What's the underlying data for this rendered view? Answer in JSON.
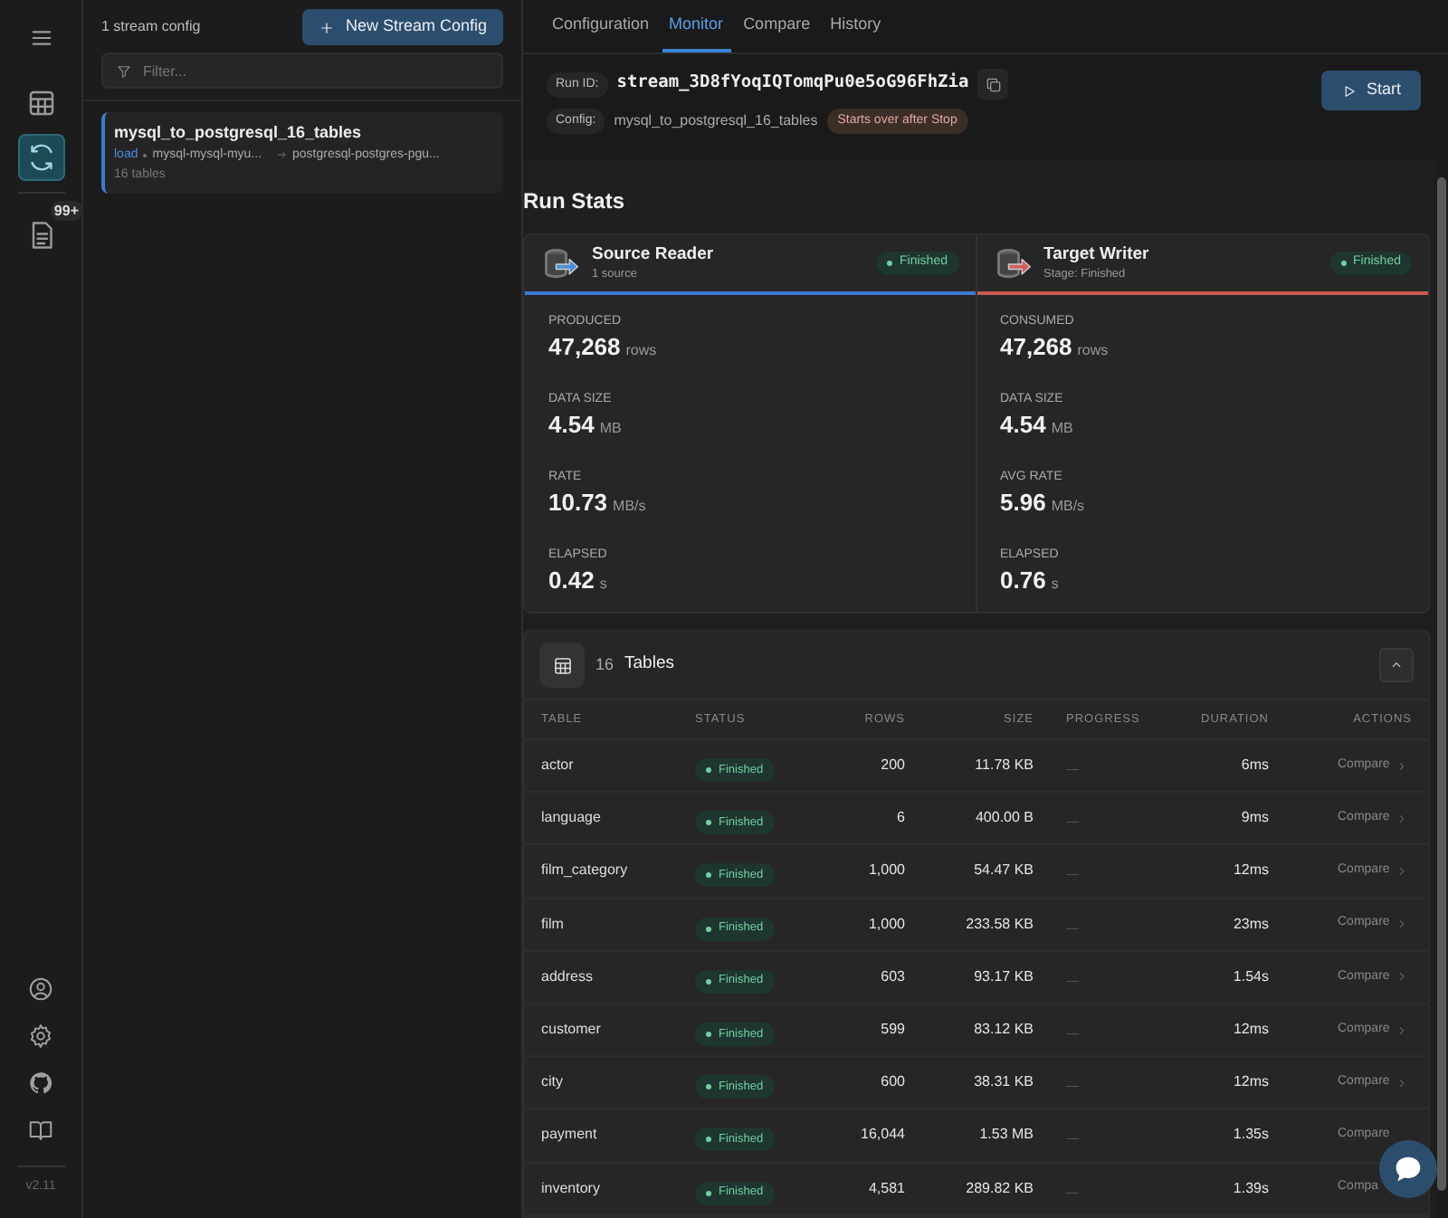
{
  "rail": {
    "items": [
      {
        "selected": false
      },
      {
        "selected": true
      },
      {
        "selected": false,
        "badge": "99+"
      }
    ],
    "version": "v2.11"
  },
  "sidebar": {
    "count": "1 stream config",
    "new_button": "New Stream Config",
    "filter": {
      "placeholder": "Filter..."
    },
    "configs": [
      {
        "name": "mysql_to_postgresql_16_tables",
        "mode": "load",
        "source": "mysql-mysql-myu...",
        "target": "postgresql-postgres-pgu...",
        "tables": "16 tables",
        "selected": true
      }
    ]
  },
  "tabs": [
    {
      "label": "Configuration",
      "selected": false
    },
    {
      "label": "Monitor",
      "selected": true
    },
    {
      "label": "Compare",
      "selected": false
    },
    {
      "label": "History",
      "selected": false
    }
  ],
  "run": {
    "id_label": "Run ID:",
    "id": "stream_3D8fYoqIQTomqPu0e5oG96FhZia",
    "config_label": "Config:",
    "config": "mysql_to_postgresql_16_tables",
    "note": "Starts over after Stop",
    "start": "Start"
  },
  "run_stats": {
    "title": "Run Stats",
    "panels": [
      {
        "kind": "source",
        "title": "Source Reader",
        "subtitle": "1 source",
        "status": "Finished",
        "metrics": [
          {
            "label": "PRODUCED",
            "value": "47,268",
            "unit": "rows"
          },
          {
            "label": "DATA SIZE",
            "value": "4.54",
            "unit": "MB"
          },
          {
            "label": "RATE",
            "value": "10.73",
            "unit": "MB/s"
          },
          {
            "label": "ELAPSED",
            "value": "0.42",
            "unit": "s"
          }
        ]
      },
      {
        "kind": "target",
        "title": "Target Writer",
        "subtitle": "Stage: Finished",
        "status": "Finished",
        "metrics": [
          {
            "label": "CONSUMED",
            "value": "47,268",
            "unit": "rows"
          },
          {
            "label": "DATA SIZE",
            "value": "4.54",
            "unit": "MB"
          },
          {
            "label": "AVG RATE",
            "value": "5.96",
            "unit": "MB/s"
          },
          {
            "label": "ELAPSED",
            "value": "0.76",
            "unit": "s"
          }
        ]
      }
    ]
  },
  "tables": {
    "count": "16",
    "title": "Tables",
    "expanded": true,
    "columns": [
      "TABLE",
      "STATUS",
      "ROWS",
      "SIZE",
      "PROGRESS",
      "DURATION",
      "ACTIONS"
    ],
    "rows": [
      {
        "table": "actor",
        "status": "Finished",
        "rows": "200",
        "size": "11.78 KB",
        "progress": "—",
        "duration": "6ms",
        "action": "Compare",
        "chevron": true
      },
      {
        "table": "language",
        "status": "Finished",
        "rows": "6",
        "size": "400.00 B",
        "progress": "—",
        "duration": "9ms",
        "action": "Compare",
        "chevron": true
      },
      {
        "table": "film_category",
        "status": "Finished",
        "rows": "1,000",
        "size": "54.47 KB",
        "progress": "—",
        "duration": "12ms",
        "action": "Compare",
        "chevron": true
      },
      {
        "table": "film",
        "status": "Finished",
        "rows": "1,000",
        "size": "233.58 KB",
        "progress": "—",
        "duration": "23ms",
        "action": "Compare",
        "chevron": true
      },
      {
        "table": "address",
        "status": "Finished",
        "rows": "603",
        "size": "93.17 KB",
        "progress": "—",
        "duration": "1.54s",
        "action": "Compare",
        "chevron": true
      },
      {
        "table": "customer",
        "status": "Finished",
        "rows": "599",
        "size": "83.12 KB",
        "progress": "—",
        "duration": "12ms",
        "action": "Compare",
        "chevron": true
      },
      {
        "table": "city",
        "status": "Finished",
        "rows": "600",
        "size": "38.31 KB",
        "progress": "—",
        "duration": "12ms",
        "action": "Compare",
        "chevron": true
      },
      {
        "table": "payment",
        "status": "Finished",
        "rows": "16,044",
        "size": "1.53 MB",
        "progress": "—",
        "duration": "1.35s",
        "action": "Compare",
        "chevron": false
      },
      {
        "table": "inventory",
        "status": "Finished",
        "rows": "4,581",
        "size": "289.82 KB",
        "progress": "—",
        "duration": "1.39s",
        "action": "Compa",
        "chevron": false
      }
    ]
  }
}
